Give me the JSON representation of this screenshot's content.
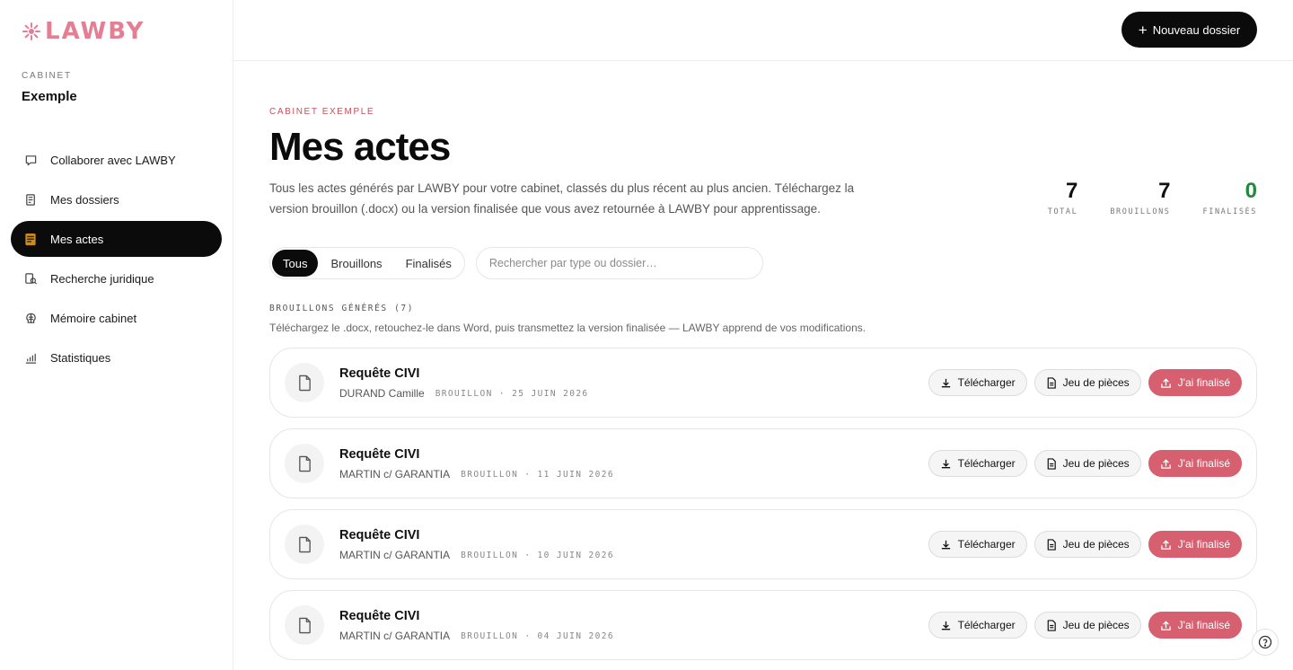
{
  "brand": {
    "name": "LAWBY",
    "color": "#e37e93"
  },
  "sidebar": {
    "cabinet_label": "CABINET",
    "cabinet_name": "Exemple",
    "items": [
      {
        "label": "Collaborer avec LAWBY",
        "icon": "chat-icon",
        "active": false
      },
      {
        "label": "Mes dossiers",
        "icon": "folder-icon",
        "active": false
      },
      {
        "label": "Mes actes",
        "icon": "document-icon",
        "active": true
      },
      {
        "label": "Recherche juridique",
        "icon": "search-law-icon",
        "active": false
      },
      {
        "label": "Mémoire cabinet",
        "icon": "brain-icon",
        "active": false
      },
      {
        "label": "Statistiques",
        "icon": "chart-icon",
        "active": false
      }
    ]
  },
  "header": {
    "new_button": "Nouveau dossier"
  },
  "page": {
    "eyebrow": "CABINET EXEMPLE",
    "title": "Mes actes",
    "description": "Tous les actes générés par LAWBY pour votre cabinet, classés du plus récent au plus ancien. Téléchargez la version brouillon (.docx) ou la version finalisée que vous avez retournée à LAWBY pour apprentissage."
  },
  "stats": [
    {
      "value": "7",
      "label": "TOTAL"
    },
    {
      "value": "7",
      "label": "BROUILLONS"
    },
    {
      "value": "0",
      "label": "FINALISÉS",
      "color": "#1f8a3b"
    }
  ],
  "filters": {
    "tabs": [
      {
        "label": "Tous",
        "active": true
      },
      {
        "label": "Brouillons",
        "active": false
      },
      {
        "label": "Finalisés",
        "active": false
      }
    ],
    "search_placeholder": "Rechercher par type ou dossier…"
  },
  "section": {
    "label": "BROUILLONS GÉNÉRÉS (7)",
    "hint": "Téléchargez le .docx, retouchez-le dans Word, puis transmettez la version finalisée — LAWBY apprend de vos modifications."
  },
  "actions": {
    "download": "Télécharger",
    "pieces": "Jeu de pièces",
    "finalize": "J'ai finalisé"
  },
  "documents": [
    {
      "title": "Requête CIVI",
      "client": "DURAND Camille",
      "status": "BROUILLON · 25 JUIN 2026"
    },
    {
      "title": "Requête CIVI",
      "client": "MARTIN c/ GARANTIA",
      "status": "BROUILLON · 11 JUIN 2026"
    },
    {
      "title": "Requête CIVI",
      "client": "MARTIN c/ GARANTIA",
      "status": "BROUILLON · 10 JUIN 2026"
    },
    {
      "title": "Requête CIVI",
      "client": "MARTIN c/ GARANTIA",
      "status": "BROUILLON · 04 JUIN 2026"
    }
  ],
  "colors": {
    "accent": "#d65f70",
    "eyebrow": "#c8505f",
    "success": "#1f8a3b"
  }
}
